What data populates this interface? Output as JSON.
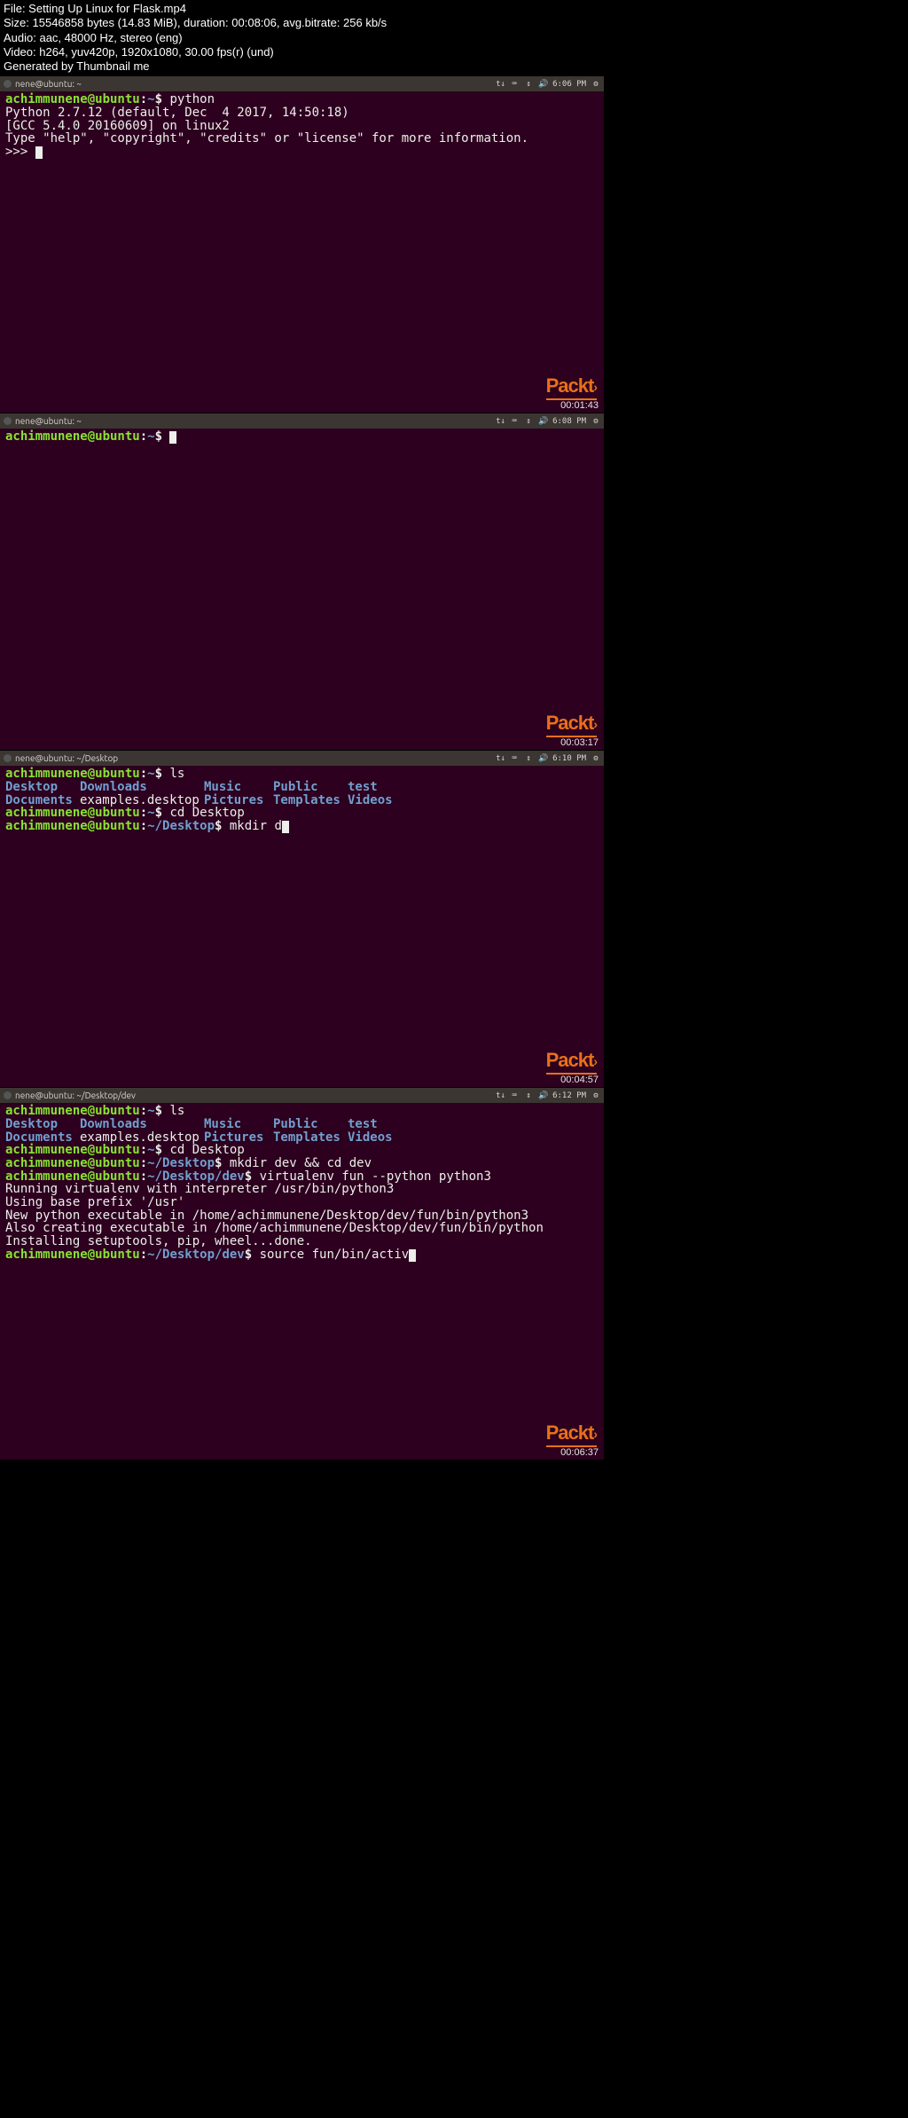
{
  "file_meta": {
    "file": "File: Setting Up Linux for Flask.mp4",
    "size": "Size: 15546858 bytes (14.83 MiB), duration: 00:08:06, avg.bitrate: 256 kb/s",
    "audio": "Audio: aac, 48000 Hz, stereo (eng)",
    "video": "Video: h264, yuv420p, 1920x1080, 30.00 fps(r) (und)",
    "generated": "Generated by Thumbnail me"
  },
  "packt_label": "Packt",
  "packt_gt": "›",
  "system_tray": {
    "lang": "t↓",
    "keyboard": "⌨",
    "net": "↕",
    "sound": "🔊",
    "power": "⚙"
  },
  "panel1": {
    "titlebar_title": "nene@ubuntu: ~",
    "titlebar_time": "6:06 PM",
    "prompt_user": "achimmunene@ubuntu",
    "prompt_sep": ":",
    "prompt_path": "~",
    "prompt_dollar": "$",
    "cmd": " python",
    "line_version": "Python 2.7.12 (default, Dec  4 2017, 14:50:18) ",
    "line_gcc": "[GCC 5.4.0 20160609] on linux2",
    "line_help": "Type \"help\", \"copyright\", \"credits\" or \"license\" for more information.",
    "repl_prompt": ">>> ",
    "timestamp": "00:01:43"
  },
  "panel2": {
    "titlebar_title": "nene@ubuntu: ~",
    "titlebar_time": "6:08 PM",
    "prompt_user": "achimmunene@ubuntu",
    "prompt_sep": ":",
    "prompt_path": "~",
    "prompt_dollar": "$",
    "cmd": " ",
    "timestamp": "00:03:17"
  },
  "panel3": {
    "titlebar_title": "nene@ubuntu: ~/Desktop",
    "titlebar_time": "6:10 PM",
    "prompt_user": "achimmunene@ubuntu",
    "prompt_sep": ":",
    "prompt_path1": "~",
    "prompt_dollar": "$",
    "cmd_ls": " ls",
    "ls": {
      "r1c1": "Desktop",
      "r1c2": "Downloads",
      "r1c3": "Music",
      "r1c4": "Public",
      "r1c5": "test",
      "r2c1": "Documents",
      "r2c2": "examples.desktop",
      "r2c3": "Pictures",
      "r2c4": "Templates",
      "r2c5": "Videos"
    },
    "cmd_cd": " cd Desktop",
    "prompt_path2": "~/Desktop",
    "cmd_mkdir": " mkdir d",
    "timestamp": "00:04:57"
  },
  "panel4": {
    "titlebar_title": "nene@ubuntu: ~/Desktop/dev",
    "titlebar_time": "6:12 PM",
    "prompt_user": "achimmunene@ubuntu",
    "prompt_sep": ":",
    "prompt_path1": "~",
    "prompt_dollar": "$",
    "cmd_ls": " ls",
    "ls": {
      "r1c1": "Desktop",
      "r1c2": "Downloads",
      "r1c3": "Music",
      "r1c4": "Public",
      "r1c5": "test",
      "r2c1": "Documents",
      "r2c2": "examples.desktop",
      "r2c3": "Pictures",
      "r2c4": "Templates",
      "r2c5": "Videos"
    },
    "cmd_cd": " cd Desktop",
    "prompt_path2": "~/Desktop",
    "cmd_mkdir_cd": " mkdir dev && cd dev",
    "prompt_path3": "~/Desktop/dev",
    "cmd_venv": " virtualenv fun --python python3",
    "line_running": "Running virtualenv with interpreter /usr/bin/python3",
    "line_baseprefix": "Using base prefix '/usr'",
    "line_newexec": "New python executable in /home/achimmunene/Desktop/dev/fun/bin/python3",
    "line_alsoexec": "Also creating executable in /home/achimmunene/Desktop/dev/fun/bin/python",
    "line_install": "Installing setuptools, pip, wheel...done.",
    "cmd_source": " source fun/bin/activ",
    "timestamp": "00:06:37"
  }
}
